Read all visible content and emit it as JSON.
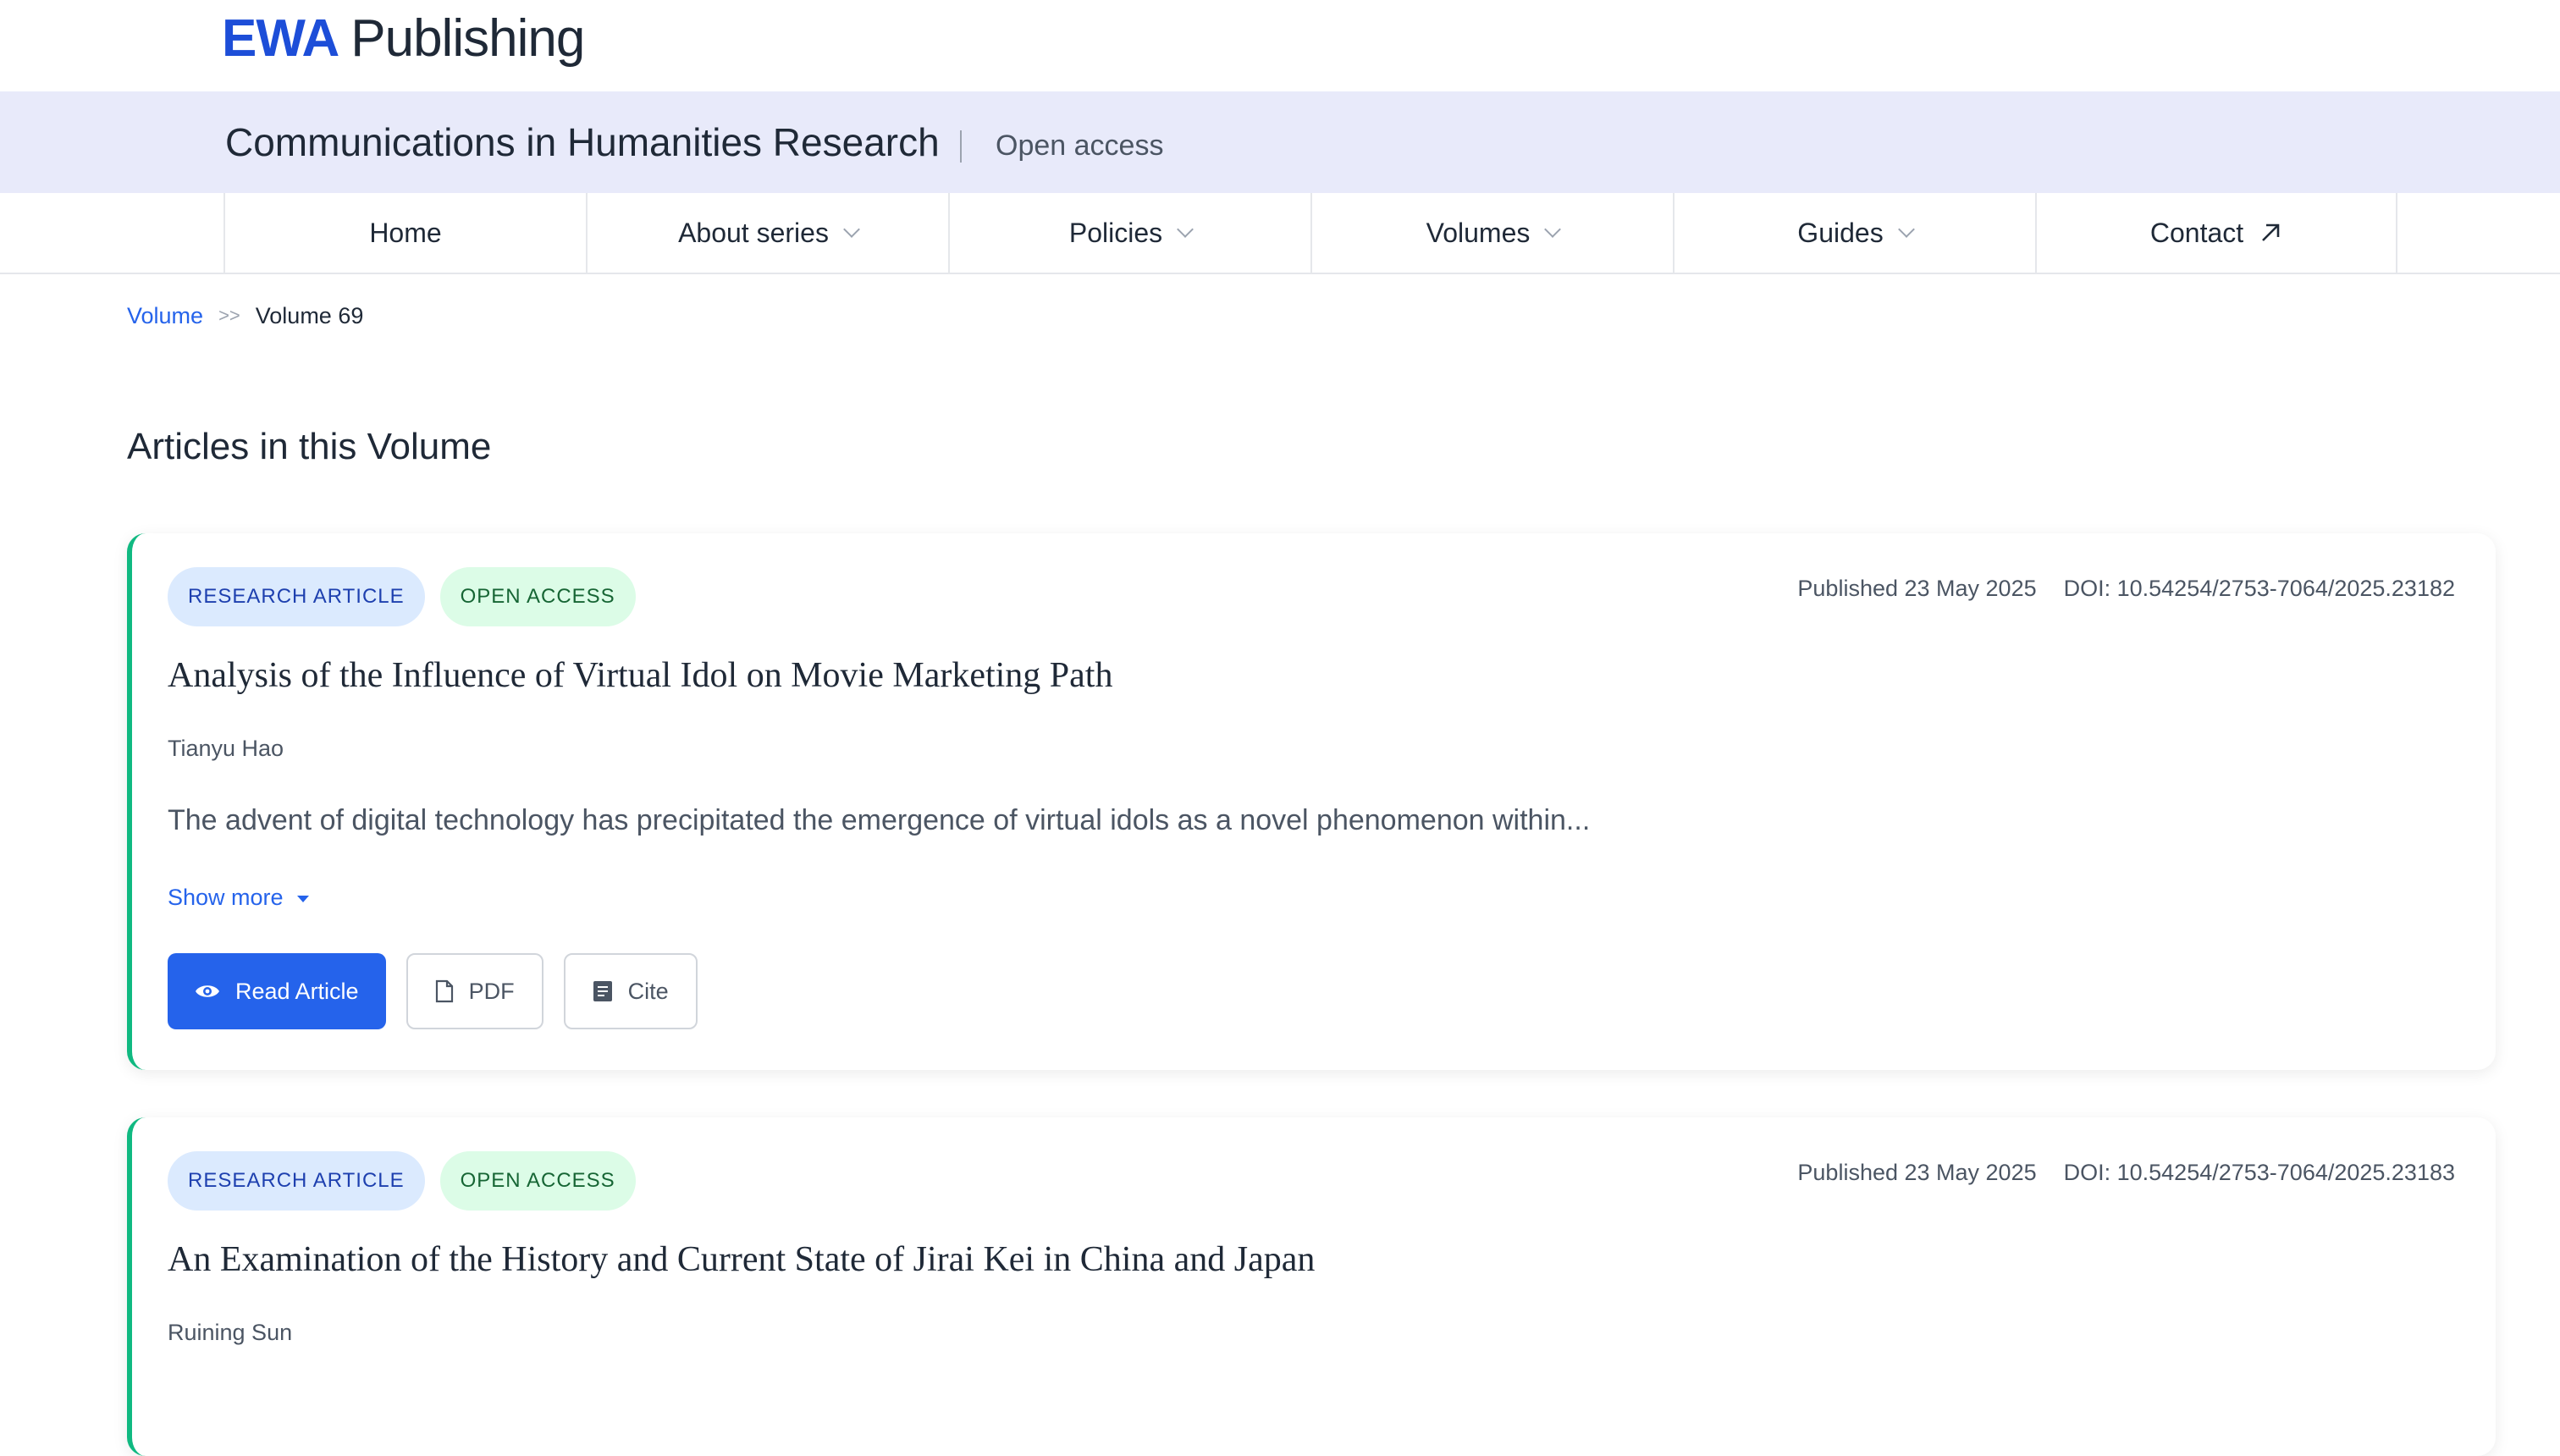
{
  "brand": {
    "logo_accent": "EWA",
    "logo_rest": "Publishing"
  },
  "journal": {
    "title": "Communications in Humanities Research",
    "access": "Open access"
  },
  "nav": [
    {
      "label": "Home",
      "icon": ""
    },
    {
      "label": "About series",
      "icon": "chevron-down-icon"
    },
    {
      "label": "Policies",
      "icon": "chevron-down-icon"
    },
    {
      "label": "Volumes",
      "icon": "chevron-down-icon"
    },
    {
      "label": "Guides",
      "icon": "chevron-down-icon"
    },
    {
      "label": "Contact",
      "icon": "external-link-icon"
    }
  ],
  "breadcrumb": {
    "parent": "Volume",
    "separator": ">>",
    "current": "Volume 69"
  },
  "section_title": "Articles in this Volume",
  "articles": [
    {
      "type": "RESEARCH ARTICLE",
      "access": "OPEN ACCESS",
      "published": "Published 23 May 2025",
      "doi": "DOI: 10.54254/2753-7064/2025.23182",
      "title": "Analysis of the Influence of Virtual Idol on Movie Marketing Path",
      "author": "Tianyu Hao",
      "abstract": "The advent of digital technology has precipitated the emergence of virtual idols as a novel phenomenon within...",
      "show_more": "Show more",
      "actions": {
        "read": "Read Article",
        "pdf": "PDF",
        "cite": "Cite"
      }
    },
    {
      "type": "RESEARCH ARTICLE",
      "access": "OPEN ACCESS",
      "published": "Published 23 May 2025",
      "doi": "DOI: 10.54254/2753-7064/2025.23183",
      "title": "An Examination of the History and Current State of Jirai Kei in China and Japan",
      "author": "Ruining Sun"
    }
  ],
  "colors": {
    "accent": "#2563eb",
    "brand": "#1d4ed8",
    "band": "#e8eafa",
    "card_border": "#10b981"
  }
}
